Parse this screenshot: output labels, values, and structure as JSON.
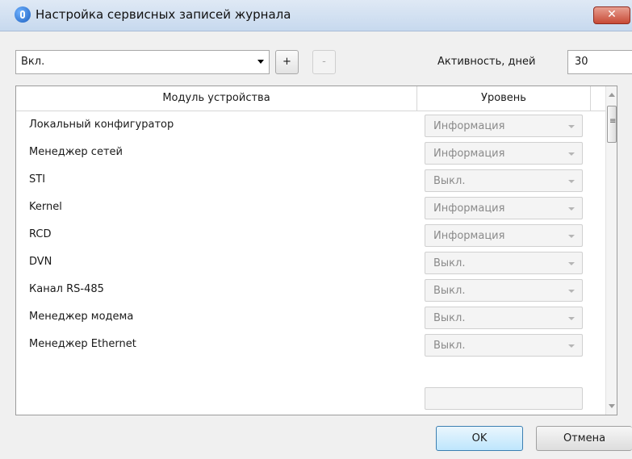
{
  "window": {
    "title": "Настройка сервисных записей журнала"
  },
  "toolbar": {
    "state_value": "Вкл.",
    "add_label": "+",
    "remove_label": "-",
    "days_label": "Активность, дней",
    "days_value": "30"
  },
  "table": {
    "col_module": "Модуль устройства",
    "col_level": "Уровень",
    "rows": [
      {
        "module": "Локальный конфигуратор",
        "level": "Информация"
      },
      {
        "module": "Менеджер сетей",
        "level": "Информация"
      },
      {
        "module": "STI",
        "level": "Выкл."
      },
      {
        "module": "Kernel",
        "level": "Информация"
      },
      {
        "module": "RCD",
        "level": "Информация"
      },
      {
        "module": "DVN",
        "level": "Выкл."
      },
      {
        "module": "Канал RS-485",
        "level": "Выкл."
      },
      {
        "module": "Менеджер модема",
        "level": "Выкл."
      },
      {
        "module": "Менеджер Ethernet",
        "level": "Выкл."
      }
    ]
  },
  "buttons": {
    "ok_label": "OK",
    "cancel_label": "Отмена"
  }
}
